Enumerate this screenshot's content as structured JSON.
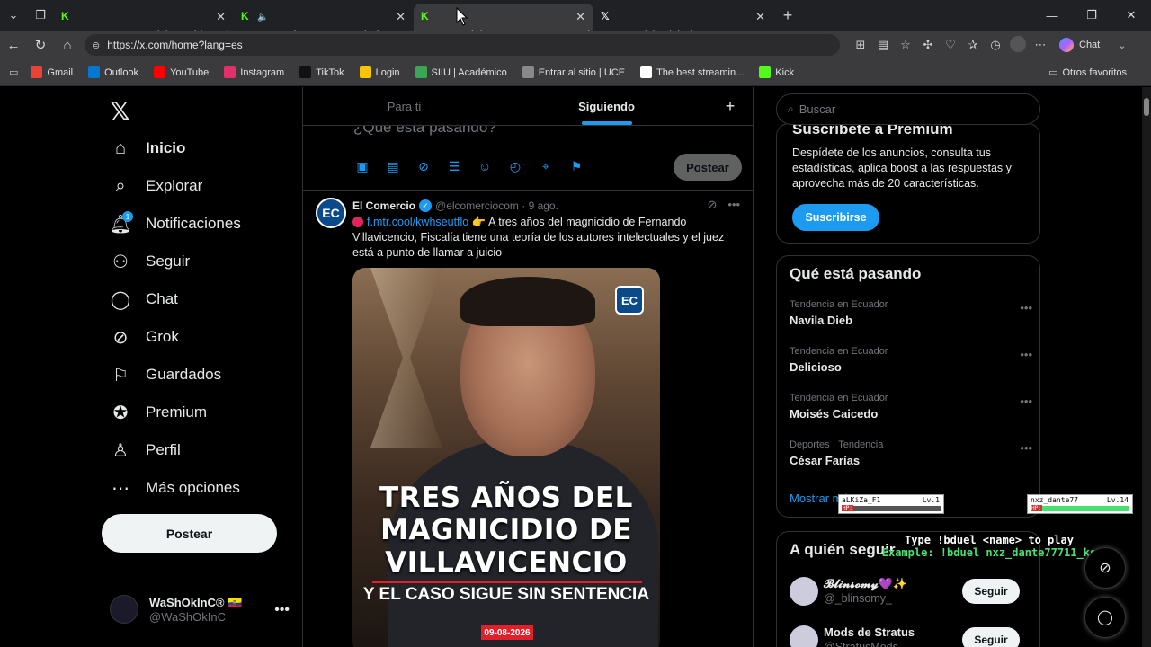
{
  "browser": {
    "tabs": [
      {
        "title": "Stream - Kick Dashboard",
        "favicon": "kick-icon",
        "color": "#53fc18",
        "active": false
      },
      {
        "title": "WiseGuy - Watch the VOD on",
        "favicon": "kick-icon",
        "color": "#53fc18",
        "active": false,
        "audio": true
      },
      {
        "title": "Diab EMT Stream - Watch Live on",
        "favicon": "kick-icon",
        "color": "#53fc18",
        "active": true
      },
      {
        "title": "(1) Inicio / X",
        "favicon": "x-icon",
        "color": "#ffffff",
        "active": false
      }
    ],
    "url": "https://x.com/home?lang=es",
    "copilot_label": "Chat",
    "bookmarks": [
      {
        "label": "Gmail",
        "color": "#ea4335"
      },
      {
        "label": "Outlook",
        "color": "#0078d4"
      },
      {
        "label": "YouTube",
        "color": "#ff0000"
      },
      {
        "label": "Instagram",
        "color": "#e1306c"
      },
      {
        "label": "TikTok",
        "color": "#111111"
      },
      {
        "label": "Login",
        "color": "#f7c600"
      },
      {
        "label": "SIIU | Académico",
        "color": "#3aa655"
      },
      {
        "label": "Entrar al sitio | UCE",
        "color": "#8a8a8a"
      },
      {
        "label": "The best streamin...",
        "color": "#ffffff"
      },
      {
        "label": "Kick",
        "color": "#53fc18"
      }
    ],
    "other_bookmarks": "Otros favoritos"
  },
  "nav": {
    "items": [
      {
        "label": "Inicio",
        "icon": "home-icon",
        "active": true
      },
      {
        "label": "Explorar",
        "icon": "search-icon"
      },
      {
        "label": "Notificaciones",
        "icon": "bell-icon",
        "badge": "1"
      },
      {
        "label": "Seguir",
        "icon": "add-person-icon"
      },
      {
        "label": "Chat",
        "icon": "chat-bubble-icon"
      },
      {
        "label": "Grok",
        "icon": "grok-icon"
      },
      {
        "label": "Guardados",
        "icon": "bookmark-icon"
      },
      {
        "label": "Premium",
        "icon": "verified-badge-icon"
      },
      {
        "label": "Perfil",
        "icon": "person-icon"
      },
      {
        "label": "Más opciones",
        "icon": "more-circle-icon"
      }
    ],
    "post_label": "Postear",
    "profile": {
      "name": "WaShOkInC® 🇪🇨",
      "handle": "@WaShOkInC"
    }
  },
  "feed": {
    "tabs": [
      "Para ti",
      "Siguiendo"
    ],
    "active_tab": "Siguiendo",
    "composer_placeholder": "¿Qué está pasando?",
    "composer_post": "Postear",
    "tweet": {
      "author": "El Comercio",
      "handle": "@elcomerciocom",
      "time": "9 ago.",
      "avatar_text": "EC",
      "link": "f.mtr.cool/kwhseutflo",
      "text": "👉 A tres años del magnicidio de Fernando Villavicencio, Fiscalía tiene una teoría de los autores intelectuales y el juez está a punto de llamar a juicio",
      "image": {
        "headline": "TRES AÑOS DEL MAGNICIDIO DE VILLAVICENCIO",
        "subheadline": "Y EL CASO SIGUE SIN SENTENCIA",
        "date": "09-08-2026",
        "logo": "EC"
      }
    }
  },
  "right": {
    "search_placeholder": "Buscar",
    "premium": {
      "title": "Suscríbete a Premium",
      "description": "Despídete de los anuncios, consulta tus estadísticas, aplica boost a las respuestas y aprovecha más de 20 características.",
      "button": "Suscribirse"
    },
    "trends": {
      "title": "Qué está pasando",
      "items": [
        {
          "context": "Tendencia en Ecuador",
          "name": "Navila Dieb"
        },
        {
          "context": "Tendencia en Ecuador",
          "name": "Delicioso"
        },
        {
          "context": "Tendencia en Ecuador",
          "name": "Moisés Caicedo"
        },
        {
          "context": "Deportes · Tendencia",
          "name": "César Farías"
        }
      ],
      "show_more": "Mostrar más"
    },
    "follow": {
      "title": "A quién seguir",
      "items": [
        {
          "name": "𝓑𝓵𝓲𝓷𝓼𝓸𝓶𝔂💜✨",
          "handle": "@_blinsomy_",
          "button": "Seguir"
        },
        {
          "name": "Mods de Stratus",
          "handle": "@StratusMods",
          "button": "Seguir"
        }
      ]
    }
  },
  "overlay": {
    "player1": {
      "name": "aLKiZa_F1",
      "level": "Lv.1",
      "hp_label": "HP:",
      "hp": 0.0
    },
    "player2": {
      "name": "nxz_dante77",
      "level": "Lv.14",
      "hp_label": "HP:",
      "hp": 1.0
    },
    "duel_line1": "Type !bduel <name> to play",
    "duel_line2": "Example: !bduel nxz_dante77711_ks"
  }
}
